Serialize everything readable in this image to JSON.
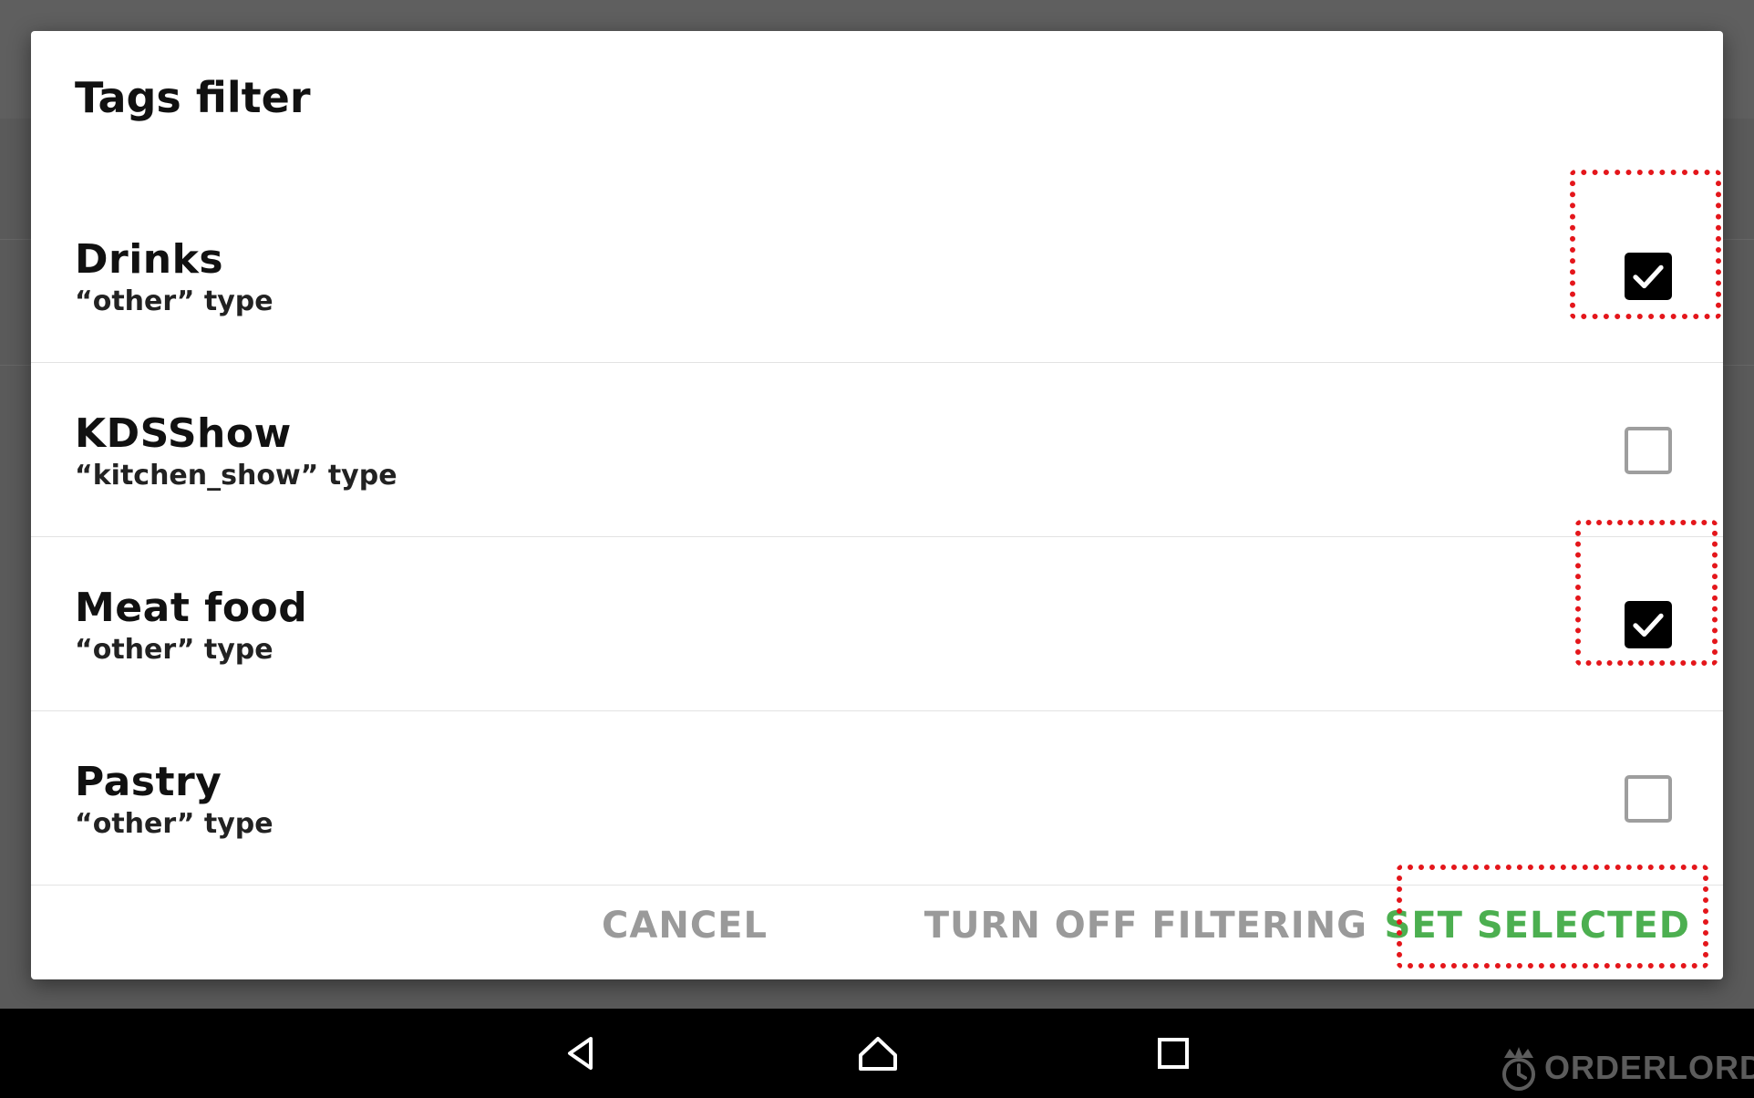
{
  "dialog": {
    "title": "Tags filter",
    "tags": [
      {
        "name": "Drinks",
        "type": "“other” type",
        "checked": true
      },
      {
        "name": "KDSShow",
        "type": "“kitchen_show” type",
        "checked": false
      },
      {
        "name": "Meat food",
        "type": "“other” type",
        "checked": true
      },
      {
        "name": "Pastry",
        "type": "“other” type",
        "checked": false
      }
    ],
    "actions": {
      "cancel_label": "CANCEL",
      "turn_off_label": "TURN OFF FILTERING",
      "set_selected_label": "SET SELECTED"
    }
  },
  "navigation": {
    "back_icon": "back-triangle-icon",
    "home_icon": "home-icon",
    "recent_icon": "recent-apps-icon"
  },
  "watermark": {
    "text": "ORDERLORD"
  },
  "colors": {
    "accent": "#4caf50",
    "highlight": "#e4161b",
    "muted_action": "#9a9a9a",
    "checkbox_checked": "#000000",
    "checkbox_unchecked_border": "#9e9e9e",
    "overlay": "#5a5a5a"
  }
}
